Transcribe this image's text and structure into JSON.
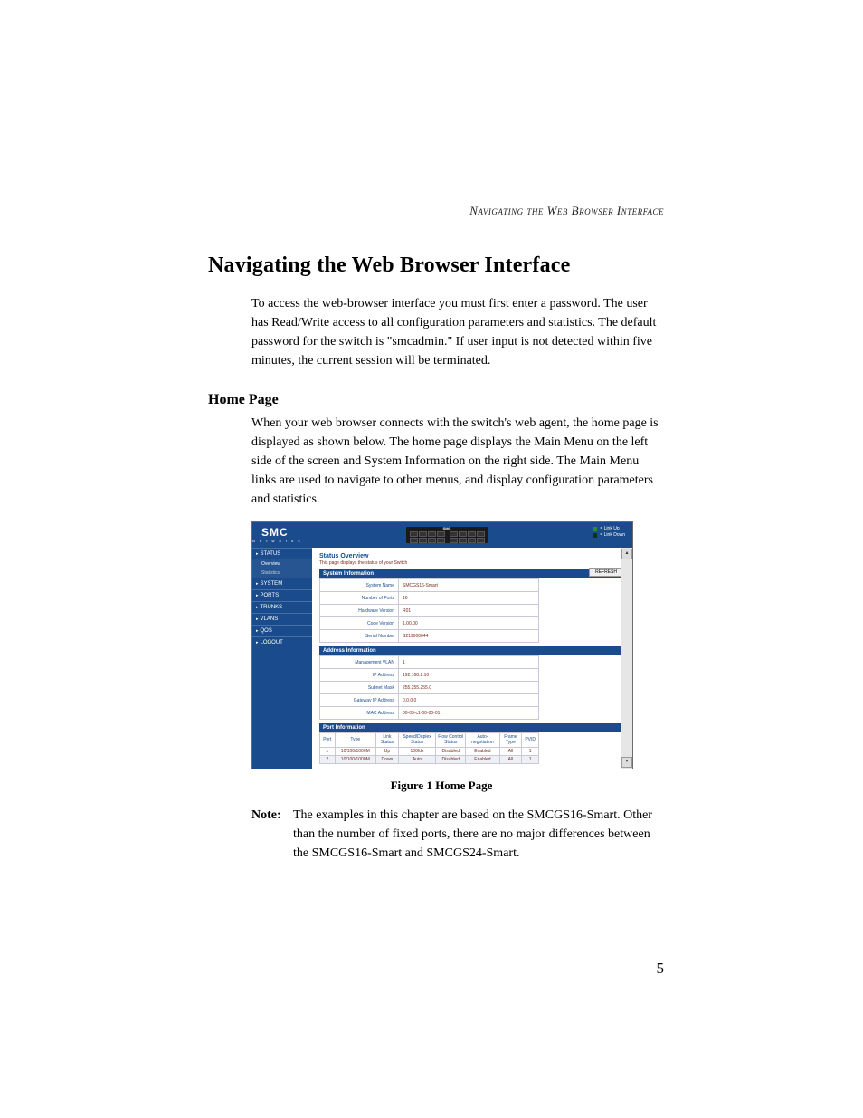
{
  "running_head": "Navigating the Web Browser Interface",
  "section_title": "Navigating the Web Browser Interface",
  "intro_para": "To access the web-browser interface you must first enter a password. The user has Read/Write access to all configuration parameters and statistics. The default password for the switch is \"smcadmin.\" If user input is not detected within five minutes, the current session will be terminated.",
  "subsection_title": "Home Page",
  "homepage_para": "When your web browser connects with the switch's web agent, the home page is displayed as shown below. The home page displays the Main Menu on the left side of the screen and System Information on the right side. The Main Menu links are used to navigate to other menus, and display configuration parameters and statistics.",
  "figure_caption": "Figure 1  Home Page",
  "note_label": "Note:",
  "note_text": "The examples in this chapter are based on the SMCGS16-Smart. Other than the number of fixed ports, there are no major differences between the SMCGS16-Smart and SMCGS24-Smart.",
  "page_number": "5",
  "screenshot": {
    "logo_main": "SMC",
    "logo_sub": "N e t w o r k s",
    "device_label": "SMC",
    "legend_up": "= Link Up",
    "legend_down": "= Link Down",
    "sidebar": {
      "items": [
        "Status",
        "System",
        "Ports",
        "Trunks",
        "VLANs",
        "QoS",
        "Logout"
      ],
      "status_subs": [
        "Overview",
        "Statistics"
      ]
    },
    "content": {
      "overview_title": "Status Overview",
      "overview_sub": "This page displays the status of your Switch",
      "refresh": "REFRESH",
      "group_sys": "System Information",
      "sys_rows": [
        [
          "System Name",
          "SMCGS16-Smart"
        ],
        [
          "Number of Ports",
          "16"
        ],
        [
          "Hardware Version",
          "R01"
        ],
        [
          "Code Version",
          "1.00.00"
        ],
        [
          "Serial Number",
          "S219000044"
        ]
      ],
      "group_addr": "Address Information",
      "addr_rows": [
        [
          "Management VLAN",
          "1"
        ],
        [
          "IP Address",
          "192.168.2.10"
        ],
        [
          "Subnet Mask",
          "255.255.255.0"
        ],
        [
          "Gateway IP Address",
          "0.0.0.0"
        ],
        [
          "MAC Address",
          "00-03-c1-00-00-01"
        ]
      ],
      "group_port": "Port Information",
      "port_headers": [
        "Port",
        "Type",
        "Link Status",
        "Speed/Duplex Status",
        "Flow Control Status",
        "Auto-negotiation",
        "Frame Type",
        "PVID"
      ],
      "port_rows": [
        [
          "1",
          "10/100/1000M",
          "Up",
          "100fdx",
          "Disabled",
          "Enabled",
          "All",
          "1"
        ],
        [
          "2",
          "10/100/1000M",
          "Down",
          "Auto",
          "Disabled",
          "Enabled",
          "All",
          "1"
        ]
      ]
    }
  }
}
